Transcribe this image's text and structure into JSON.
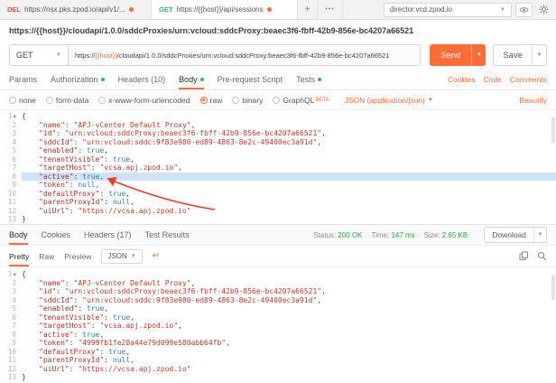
{
  "window": {
    "tabs": [
      {
        "method": "DEL",
        "url": "https://nsx.pks.zpod.io/api/v1/..."
      },
      {
        "method": "GET",
        "url": "https://{{host}}/api/sessions"
      }
    ],
    "new_tab_label": "+",
    "more_tabs_label": "•••",
    "environment": {
      "name": "director.vcd.zpod.io"
    }
  },
  "request": {
    "title": "https://{{host}}/cloudapi/1.0.0/sddcProxies/urn:vcloud:sddcProxy:beaec3f6-fbff-42b9-856e-bc4207a66521",
    "method": "GET",
    "url": {
      "pre": "https://",
      "variable": "{{host}}",
      "post": "/cloudapi/1.0.0/sddcProxies/urn:vcloud:sddcProxy:beaec3f6-fbff-42b9-856e-bc4207a66521"
    },
    "send_label": "Send",
    "save_label": "Save",
    "tabs": [
      {
        "label": "Params"
      },
      {
        "label": "Authorization"
      },
      {
        "label": "Headers (10)"
      },
      {
        "label": "Body"
      },
      {
        "label": "Pre-request Script"
      },
      {
        "label": "Tests"
      }
    ],
    "links": {
      "cookies": "Cookies",
      "code": "Code",
      "comments": "Comments"
    },
    "body_modes": [
      "none",
      "form-data",
      "x-www-form-urlencoded",
      "raw",
      "binary",
      "GraphQL"
    ],
    "selected_mode": "raw",
    "graphql_beta": "BETA",
    "content_type": "JSON (application/json)",
    "beautify_label": "Beautify"
  },
  "request_body": {
    "open": "{",
    "close": "}",
    "entries": [
      {
        "key": "name",
        "value": "APJ-vCenter Default Proxy",
        "type": "string"
      },
      {
        "key": "id",
        "value": "urn:vcloud:sddcProxy:beaec3f6-fbff-42b9-856e-bc4207a66521",
        "type": "string"
      },
      {
        "key": "sddcId",
        "value": "urn:vcloud:sddc:9f83e980-ed89-4863-8e2c-49400ec3a91d",
        "type": "string"
      },
      {
        "key": "enabled",
        "value": "true",
        "type": "bool"
      },
      {
        "key": "tenantVisible",
        "value": "true",
        "type": "bool"
      },
      {
        "key": "targetHost",
        "value": "vcsa.apj.zpod.io",
        "type": "string"
      },
      {
        "key": "active",
        "value": "true",
        "type": "bool",
        "highlight": true
      },
      {
        "key": "token",
        "value": "null",
        "type": "null"
      },
      {
        "key": "defaultProxy",
        "value": "true",
        "type": "bool"
      },
      {
        "key": "parentProxyId",
        "value": "null",
        "type": "null"
      },
      {
        "key": "uiUrl",
        "value": "https://vcsa.apj.zpod.io",
        "type": "string"
      }
    ]
  },
  "response": {
    "tabs": [
      {
        "label": "Body"
      },
      {
        "label": "Cookies"
      },
      {
        "label": "Headers (17)"
      },
      {
        "label": "Test Results"
      }
    ],
    "status": {
      "label": "Status:",
      "value": "200 OK"
    },
    "time": {
      "label": "Time:",
      "value": "147 ms"
    },
    "size": {
      "label": "Size:",
      "value": "2.65 KB"
    },
    "download_label": "Download",
    "view_tabs": [
      "Pretty",
      "Raw",
      "Preview"
    ],
    "active_view": "Pretty",
    "language": "JSON"
  },
  "response_body": {
    "open": "{",
    "close": "}",
    "entries": [
      {
        "key": "name",
        "value": "APJ-vCenter Default Proxy",
        "type": "string"
      },
      {
        "key": "id",
        "value": "urn:vcloud:sddcProxy:beaec3f6-fbff-42b9-856e-bc4207a66521",
        "type": "string"
      },
      {
        "key": "sddcId",
        "value": "urn:vcloud:sddc:9f83e980-ed89-4863-8e2c-49400ec3a91d",
        "type": "string"
      },
      {
        "key": "enabled",
        "value": "true",
        "type": "bool"
      },
      {
        "key": "tenantVisible",
        "value": "true",
        "type": "bool"
      },
      {
        "key": "targetHost",
        "value": "vcsa.apj.zpod.io",
        "type": "string"
      },
      {
        "key": "active",
        "value": "true",
        "type": "bool"
      },
      {
        "key": "token",
        "value": "4999fb1fe28a44e79d099e580abb64fb",
        "type": "string"
      },
      {
        "key": "defaultProxy",
        "value": "true",
        "type": "bool"
      },
      {
        "key": "parentProxyId",
        "value": "null",
        "type": "null"
      },
      {
        "key": "uiUrl",
        "value": "https://vcsa.apj.zpod.io",
        "type": "string"
      }
    ]
  },
  "colors": {
    "accent": "#ff6c37",
    "green": "#2bb673",
    "method_delete": "#e0564a",
    "status_green": "#29a643",
    "json_key": "#a93226",
    "json_string": "#c0392b",
    "json_bool": "#2f7dbe",
    "json_null": "#2f7dbe",
    "highlight": "#cfe3f8",
    "arrow": "#ee3b26"
  }
}
